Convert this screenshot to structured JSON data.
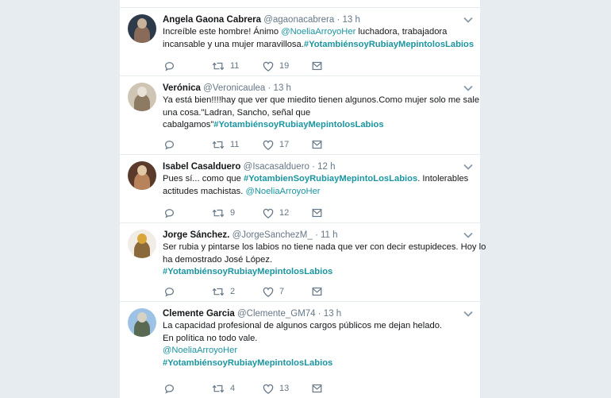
{
  "timeline": {
    "tweets": [
      {
        "name": "Angela Gaona Cabrera",
        "handle": "@agaonacabrera",
        "time": "· 13 h",
        "lines": [
          [
            "Increíble este hombre! Ánimo ",
            "@NoeliaArroyoHer",
            " luchadora, trabajadora"
          ],
          [
            "incansable y una mujer maravillosa.",
            "#YotambiénsoyRubiayMepintolosLabios"
          ]
        ],
        "retweets": "11",
        "likes": "19",
        "avatar_colors": [
          "#2d3a4a",
          "#8a6a58",
          "#c9b29a"
        ]
      },
      {
        "name": "Verónica",
        "handle": "@Veronicaulea",
        "time": "· 13 h",
        "lines": [
          [
            "Ya está bien!!!!hay que ver que miedito tienen algunos.Como mujer solo me sale"
          ],
          [
            "una cosa.\"Ladran, Sancho, señal que"
          ],
          [
            "cabalgamos\"",
            "#YotambiénsoyRubiayMepintolosLabios"
          ]
        ],
        "retweets": "11",
        "likes": "17",
        "avatar_colors": [
          "#cfc5b4",
          "#8c7a62",
          "#e8e2d6"
        ]
      },
      {
        "name": "Isabel Casalduero",
        "handle": "@Isacasalduero",
        "time": "· 12 h",
        "lines": [
          [
            "Pues sí... como que ",
            "#YotambienSoyRubiayMepintoLosLabios",
            ". Intolerables"
          ],
          [
            "actitudes machistas. ",
            "@NoeliaArroyoHer"
          ]
        ],
        "retweets": "9",
        "likes": "12",
        "avatar_colors": [
          "#5a3a2a",
          "#b8825a",
          "#e2c9a6"
        ]
      },
      {
        "name": "Jorge Sánchez.",
        "handle": "@JorgeSanchezM_",
        "time": "· 11 h",
        "lines": [
          [
            "Ser rubia y pintarse los labios no tiene nada que ver con decir estupideces. Hoy lo"
          ],
          [
            "ha demostrado José López."
          ],
          [
            "#YotambiénsoyRubiayMepintolosLabios"
          ]
        ],
        "retweets": "2",
        "likes": "7",
        "avatar_colors": [
          "#f1ede6",
          "#8a6a3a",
          "#d9a63a"
        ]
      },
      {
        "name": "Clemente Garcia",
        "handle": "@Clemente_GM74",
        "time": "· 13 h",
        "lines": [
          [
            "La capacidad profesional de algunos cargos públicos me dejan helado."
          ],
          [
            "En política no todo vale."
          ],
          [
            "@NoeliaArroyoHer"
          ],
          [
            "#YotambiénsoyRubiayMepintolosLabios"
          ]
        ],
        "retweets": "4",
        "likes": "13",
        "avatar_colors": [
          "#9cc3e6",
          "#5a6a52",
          "#d8d2c4"
        ]
      }
    ]
  }
}
